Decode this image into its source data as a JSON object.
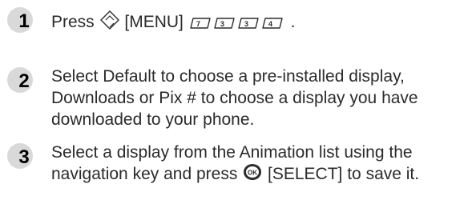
{
  "steps": [
    {
      "number": "1",
      "pre": "Press",
      "menu_label": "[MENU]",
      "key_labels": [
        "7",
        "3",
        "3",
        "4"
      ],
      "post": "."
    },
    {
      "number": "2",
      "text": "Select Default to choose a pre-installed display, Downloads or Pix # to choose a display you have downloaded to your phone."
    },
    {
      "number": "3",
      "pre": "Select a display from the Animation list using the navigation key and press",
      "select_label": "[SELECT]",
      "post": "to save it."
    }
  ],
  "icons": {
    "menu_key": "navigation-menu-key-icon",
    "ok_key": "ok-key-icon"
  }
}
